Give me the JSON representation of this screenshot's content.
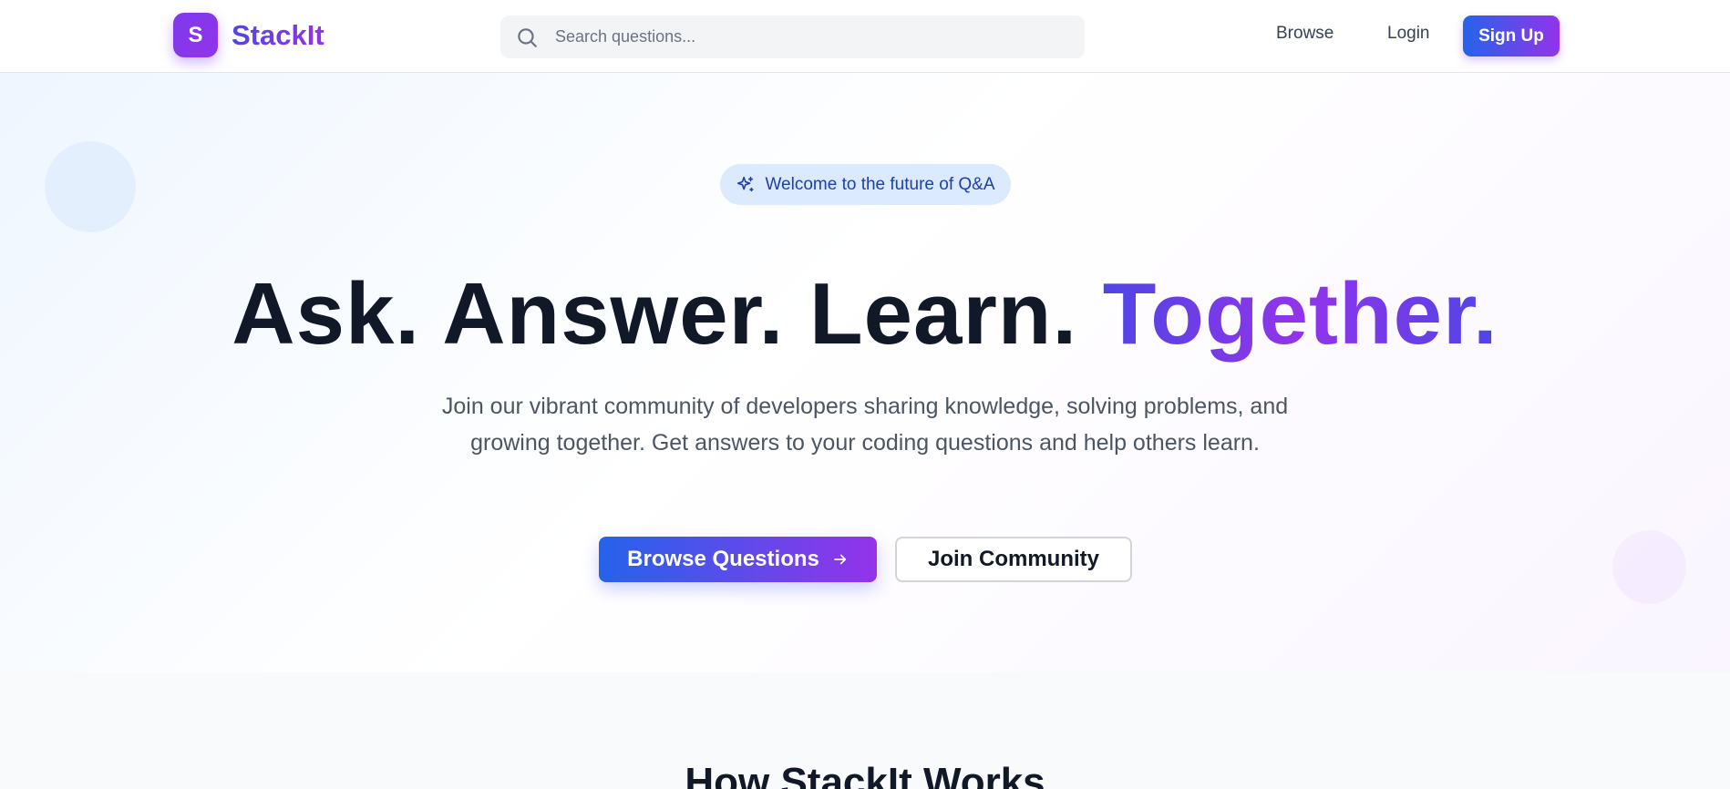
{
  "header": {
    "logo_letter": "S",
    "brand": "StackIt",
    "search_placeholder": "Search questions...",
    "nav": {
      "browse": "Browse",
      "login": "Login",
      "signup": "Sign Up"
    }
  },
  "hero": {
    "badge": "Welcome to the future of Q&A",
    "title_main": "Ask. Answer. Learn. ",
    "title_accent": "Together.",
    "subtitle": "Join our vibrant community of developers sharing knowledge, solving problems, and growing together. Get answers to your coding questions and help others learn.",
    "primary_button": "Browse Questions",
    "secondary_button": "Join Community"
  },
  "how": {
    "title": "How StackIt Works"
  },
  "colors": {
    "brand_gradient_start": "#2563eb",
    "brand_gradient_end": "#9333ea",
    "badge_bg": "#dbeafe",
    "badge_text": "#1e40af",
    "heading": "#111827"
  },
  "icons": {
    "search": "search-icon",
    "sparkle": "sparkles-icon",
    "arrow": "arrow-right-icon"
  }
}
